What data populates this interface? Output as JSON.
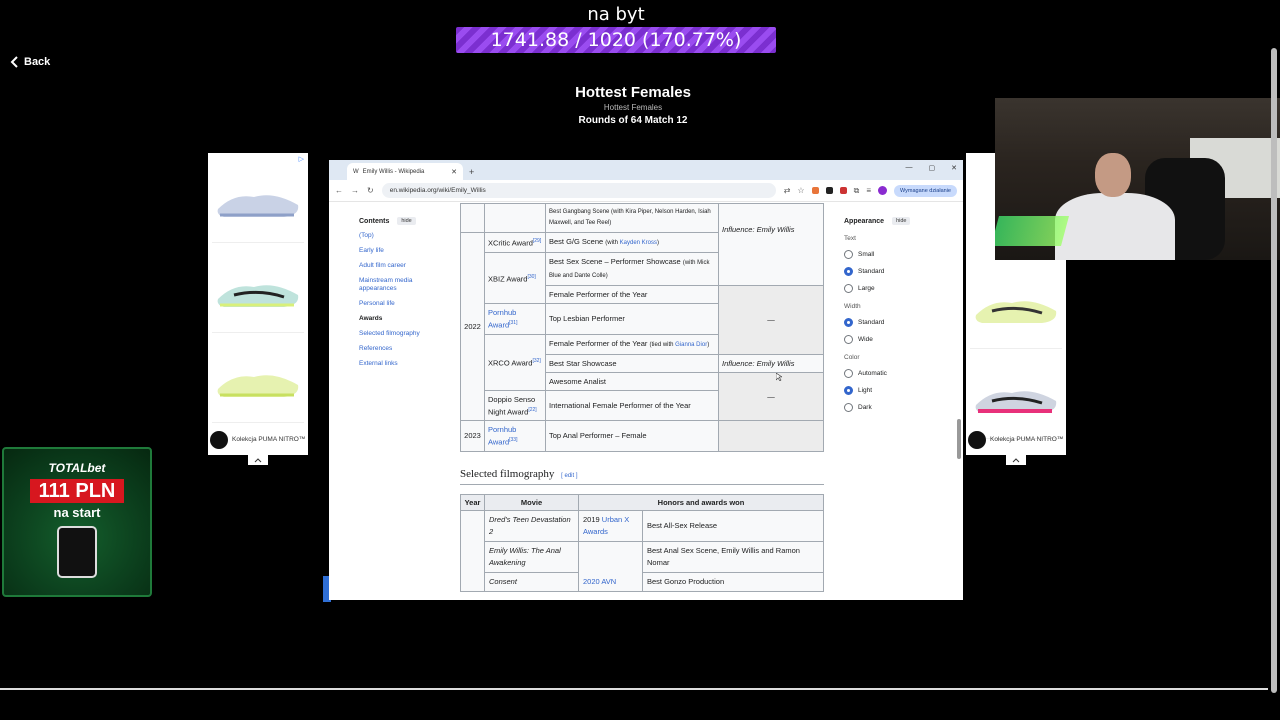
{
  "overlay": {
    "title": "na byt",
    "progress_text": "1741.88 / 1020 (170.77%)",
    "progress_fraction": 1.7077
  },
  "nav": {
    "back_label": "Back"
  },
  "header": {
    "title": "Hottest Females",
    "subtitle": "Hottest Females",
    "match": "Rounds of 64 Match 12"
  },
  "ads": {
    "left": {
      "caption": "Kolekcja PUMA NITRO™",
      "domain": "PUMA.com"
    },
    "right": {
      "caption": "Kolekcja PUMA NITRO™",
      "domain": "PUMA.com"
    }
  },
  "totalbet": {
    "brand": "TOTALbet",
    "amount": "111 PLN",
    "sub": "na start"
  },
  "browser": {
    "tab_title": "Emily Willis - Wikipedia",
    "url": "en.wikipedia.org/wiki/Emily_Willis",
    "required_action": "Wymagane działanie",
    "toc": {
      "heading": "Contents",
      "hide": "hide",
      "items": [
        "(Top)",
        "Early life",
        "Adult film career",
        "Mainstream media appearances",
        "Personal life",
        "Awards",
        "Selected filmography",
        "References",
        "External links"
      ]
    },
    "appearance": {
      "heading": "Appearance",
      "hide": "hide",
      "text_label": "Text",
      "text_options": [
        "Small",
        "Standard",
        "Large"
      ],
      "width_label": "Width",
      "width_options": [
        "Standard",
        "Wide"
      ],
      "color_label": "Color",
      "color_options": [
        "Automatic",
        "Light",
        "Dark"
      ]
    },
    "awards_rows": {
      "top_cut": "Best Gangbang Scene (with Kira Piper, Nelson Harden, Isiah Maxwell, and Tee Reel)",
      "year_2022": "2022",
      "xcritic": "XCritic Award",
      "xcritic_ref": "[29]",
      "gg": "Best G/G Scene",
      "gg_with": "(with ",
      "gg_name": "Kayden Kross",
      "gg_close": ")",
      "influence": "Influence: Emily Willis",
      "xbiz": "XBIZ Award",
      "xbiz_ref": "[30]",
      "bss": "Best Sex Scene – Performer Showcase",
      "bss_with": "(with Mick Blue and Dante Colle)",
      "fpy": "Female Performer of the Year",
      "pornhub": "Pornhub Award",
      "pornhub_ref": "[31]",
      "tlp": "Top Lesbian Performer",
      "dash": "—",
      "fpy_tied": "Female Performer of the Year",
      "tied_with": "(tied with ",
      "tied_name": "Gianna Dior",
      "tied_close": ")",
      "xrco": "XRCO Award",
      "xrco_ref": "[32]",
      "bsh": "Best Star Showcase",
      "influence2": "Influence: Emily Willis",
      "aa": "Awesome Analist",
      "doppio": "Doppio Senso Night Award",
      "doppio_ref": "[22]",
      "ifpy": "International Female Performer of the Year",
      "year_2023": "2023",
      "pornhub2": "Pornhub Award",
      "pornhub2_ref": "[33]",
      "tap": "Top Anal Performer – Female"
    },
    "filmography": {
      "title": "Selected filmography",
      "edit": "edit",
      "headers": [
        "Year",
        "Movie",
        "Honors and awards won"
      ],
      "rows": [
        {
          "movie": "Dred's Teen Devastation 2",
          "award": "2019 Urban X Awards",
          "award_year": "2019 ",
          "award_name": "Urban X Awards",
          "honor": "Best All-Sex Release"
        },
        {
          "movie": "Emily Willis: The Anal Awakening",
          "honor": "Best Anal Sex Scene, Emily Willis and Ramon Nomar"
        },
        {
          "movie": "Consent",
          "award": "2020 AVN",
          "honor": "Best Gonzo Production"
        }
      ]
    }
  },
  "colors": {
    "accent": "#3366cc",
    "progress": "#7b2fd0",
    "totalbet_red": "#d7171f"
  }
}
